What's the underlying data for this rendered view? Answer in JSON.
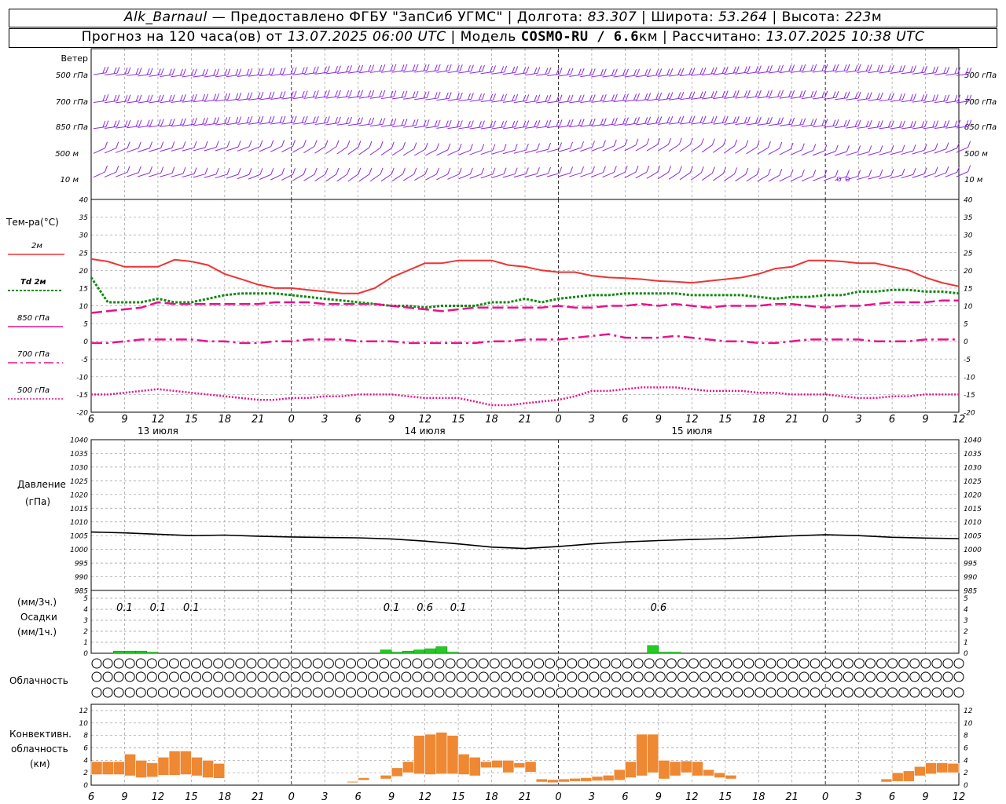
{
  "header": {
    "station": "Alk_Barnaul",
    "dash": "—",
    "provided_by": "Предоставлено ФГБУ \"ЗапСиб УГМС\"",
    "lon_label": "Долгота:",
    "lon_value": "83.307",
    "lat_label": "Широта:",
    "lat_value": "53.264",
    "alt_label": "Высота:",
    "alt_value": "223",
    "alt_unit": "м",
    "forecast_prefix": "Прогноз на 120 часа(ов) от",
    "forecast_start": "13.07.2025 06:00 UTC",
    "model_label": "Модель",
    "model_name": "COSMO-RU / 6.6",
    "model_unit": "км",
    "calc_label": "Рассчитано:",
    "calc_time": "13.07.2025 10:38 UTC"
  },
  "time_axis": {
    "hour_ticks": [
      "6",
      "9",
      "12",
      "15",
      "18",
      "21",
      "0",
      "3",
      "6",
      "9",
      "12",
      "15",
      "18",
      "21",
      "0",
      "3",
      "6",
      "9",
      "12",
      "15",
      "18",
      "21",
      "0",
      "3",
      "6",
      "9",
      "12"
    ],
    "day_labels": [
      "13 июля",
      "14 июля",
      "15 июля"
    ]
  },
  "wind_panel": {
    "title": "Ветер",
    "levels": [
      "500 гПа",
      "700 гПа",
      "850 гПа",
      "500 м",
      "10 м"
    ],
    "calm_marks": [
      "o",
      "o"
    ]
  },
  "temp_panel": {
    "title": "Тем-ра(°C)",
    "legend": [
      "2м",
      "Td 2м",
      "850 гПа",
      "700 гПа",
      "500 гПа"
    ],
    "ticks": [
      "40",
      "35",
      "30",
      "25",
      "20",
      "15",
      "10",
      "5",
      "0",
      "-5",
      "-10",
      "-15",
      "-20"
    ]
  },
  "pressure_panel": {
    "title_line1": "Давление",
    "title_line2": "(гПа)",
    "ticks": [
      "1040",
      "1035",
      "1030",
      "1025",
      "1020",
      "1015",
      "1010",
      "1005",
      "1000",
      "995",
      "990",
      "985"
    ]
  },
  "precip_panel": {
    "label_top": "(мм/3ч.)",
    "label_mid": "Осадки",
    "label_bot": "(мм/1ч.)",
    "ticks": [
      "5",
      "4",
      "3",
      "2",
      "1",
      "0"
    ],
    "amount_labels": [
      {
        "hour": 3,
        "text": "0.1"
      },
      {
        "hour": 6,
        "text": "0.1"
      },
      {
        "hour": 9,
        "text": "0.1"
      },
      {
        "hour": 27,
        "text": "0.1"
      },
      {
        "hour": 30,
        "text": "0.6"
      },
      {
        "hour": 33,
        "text": "0.1"
      },
      {
        "hour": 51,
        "text": "0.6"
      }
    ]
  },
  "cloud_panel": {
    "title": "Облачность"
  },
  "conv_panel": {
    "title_line1": "Конвективн.",
    "title_line2": "облачность",
    "title_line3": "(км)",
    "ticks": [
      "12",
      "10",
      "8",
      "6",
      "4",
      "2",
      "0"
    ]
  },
  "colors": {
    "wind": "#8a2be2",
    "t2m": "#ee3333",
    "td2m": "#118811",
    "t850": "#e8128c",
    "t700": "#e8128c",
    "t500": "#e8128c",
    "pressure": "#000000",
    "precip": "#22cc22",
    "conv": "#ee8833",
    "grid": "#9a9a9a"
  },
  "chart_data": [
    {
      "type": "line",
      "title": "Тем-ра(°C)",
      "ylim": [
        -20,
        40
      ],
      "x_hours": [
        0,
        1.5,
        3,
        4.5,
        6,
        7.5,
        9,
        10.5,
        12,
        13.5,
        15,
        16.5,
        18,
        19.5,
        21,
        22.5,
        24,
        25.5,
        27,
        28.5,
        30,
        31.5,
        33,
        34.5,
        36,
        37.5,
        39,
        40.5,
        42,
        43.5,
        45,
        46.5,
        48,
        49.5,
        51,
        52.5,
        54,
        55.5,
        57,
        58.5,
        60,
        61.5,
        63,
        64.5,
        66,
        67.5,
        69,
        70.5,
        72,
        73.5,
        75,
        76.5,
        78
      ],
      "series": [
        {
          "name": "2м",
          "values": [
            23.2,
            22.5,
            21,
            21,
            21,
            23,
            22.5,
            21.5,
            19,
            17.5,
            16,
            15,
            15,
            14.5,
            14,
            13.5,
            13.5,
            15,
            18,
            20,
            22,
            22,
            22.8,
            22.8,
            22.8,
            21.5,
            21,
            20,
            19.5,
            19.5,
            18.5,
            18,
            17.8,
            17.5,
            17,
            16.8,
            16.5,
            17,
            17.5,
            18,
            19,
            20.5,
            21,
            22.8,
            22.8,
            22.5,
            22,
            22,
            21,
            20,
            18,
            16.5,
            15.5
          ]
        },
        {
          "name": "Td 2м",
          "values": [
            18,
            11,
            11,
            11,
            12,
            11,
            11,
            12,
            13,
            13.5,
            13.5,
            13.5,
            13,
            12.5,
            12,
            11.5,
            11,
            10.5,
            10,
            10,
            9.5,
            10,
            10,
            10,
            11,
            11,
            12,
            11,
            12,
            12.5,
            13,
            13,
            13.5,
            13.5,
            13.5,
            13.5,
            13,
            13,
            13,
            13,
            12.5,
            12,
            12.5,
            12.5,
            13,
            13,
            14,
            14,
            14.5,
            14.5,
            14,
            14,
            13.5
          ]
        },
        {
          "name": "850 гПа",
          "values": [
            8,
            8.5,
            9,
            9.5,
            11,
            10.5,
            10.5,
            10.5,
            10.5,
            10.5,
            10.5,
            11,
            11,
            11,
            10.5,
            10.5,
            10.5,
            10.5,
            10,
            9.5,
            9,
            8.5,
            9,
            9.5,
            9.5,
            9.5,
            9.5,
            9.5,
            10,
            9.5,
            9.5,
            10,
            10,
            10.5,
            10,
            10.5,
            10,
            9.5,
            10,
            10,
            10,
            10.5,
            10.5,
            10,
            9.5,
            10,
            10,
            10.5,
            11,
            11,
            11,
            11.5,
            11.5
          ]
        },
        {
          "name": "700 гПа",
          "values": [
            -0.5,
            -0.5,
            0,
            0.5,
            0.5,
            0.5,
            0.5,
            0,
            0,
            -0.5,
            -0.5,
            0,
            0,
            0.5,
            0.5,
            0.5,
            0,
            0,
            0,
            -0.5,
            -0.5,
            -0.5,
            -0.5,
            -0.5,
            0,
            0,
            0.5,
            0.5,
            0.5,
            1,
            1.5,
            2,
            1,
            1,
            1,
            1.5,
            1,
            0.5,
            0,
            0,
            -0.5,
            -0.5,
            0,
            0.5,
            0.5,
            0.5,
            0.5,
            0,
            0,
            0,
            0.5,
            0.5,
            0.5
          ]
        },
        {
          "name": "500 гПа",
          "values": [
            -15,
            -15,
            -14.5,
            -14,
            -13.5,
            -14,
            -14.5,
            -15,
            -15.5,
            -16,
            -16.5,
            -16.5,
            -16,
            -16,
            -15.5,
            -15.5,
            -15,
            -15,
            -15,
            -15.5,
            -16,
            -16,
            -16,
            -17,
            -18,
            -18,
            -17.5,
            -17,
            -16.5,
            -15.5,
            -14,
            -14,
            -13.5,
            -13,
            -13,
            -13,
            -13.5,
            -14,
            -14,
            -14,
            -14.5,
            -14.5,
            -15,
            -15,
            -15,
            -15.5,
            -16,
            -16,
            -15.5,
            -15.5,
            -15,
            -15,
            -15
          ]
        }
      ]
    },
    {
      "type": "line",
      "title": "Давление",
      "ylabel": "(гПа)",
      "ylim": [
        985,
        1040
      ],
      "x_hours": [
        0,
        3,
        6,
        9,
        12,
        15,
        18,
        21,
        24,
        27,
        30,
        33,
        36,
        39,
        42,
        45,
        48,
        51,
        54,
        57,
        60,
        63,
        66,
        69,
        72,
        75,
        78
      ],
      "series": [
        {
          "name": "Давление",
          "values": [
            1006.3,
            1006,
            1005.5,
            1005,
            1005.2,
            1004.8,
            1004.5,
            1004.3,
            1004.2,
            1003.8,
            1003,
            1002,
            1000.8,
            1000.3,
            1001,
            1002,
            1002.7,
            1003.2,
            1003.6,
            1003.9,
            1004.4,
            1004.9,
            1005.3,
            1005,
            1004.4,
            1004.1,
            1003.9
          ]
        }
      ]
    },
    {
      "type": "bar",
      "title": "Осадки",
      "ylabel": "(мм/1ч.)",
      "ylim": [
        0,
        5
      ],
      "x_hours": [
        3,
        4,
        5,
        6,
        27,
        28,
        29,
        30,
        31,
        32,
        33,
        51,
        52,
        53
      ],
      "values": [
        0.2,
        0.2,
        0.2,
        0.1,
        0.3,
        0.1,
        0.2,
        0.3,
        0.4,
        0.6,
        0.1,
        0.7,
        0.1,
        0.1
      ]
    },
    {
      "type": "bar",
      "title": "Конвективн. облачность",
      "ylabel": "(км)",
      "ylim": [
        0,
        12
      ],
      "x_hours": [
        1,
        2,
        3,
        4,
        5,
        6,
        7,
        8,
        9,
        10,
        11,
        12,
        24,
        25,
        27,
        28,
        29,
        30,
        31,
        32,
        33,
        34,
        35,
        36,
        37,
        38,
        39,
        40,
        41,
        42,
        43,
        44,
        45,
        46,
        47,
        48,
        49,
        50,
        51,
        52,
        53,
        54,
        55,
        56,
        57,
        58,
        72,
        73,
        74,
        75,
        76,
        77,
        78
      ],
      "bottoms": [
        1.7,
        1.7,
        1.7,
        1.5,
        1.2,
        1.3,
        1.6,
        1.6,
        1.7,
        1.5,
        1.2,
        1.1,
        0.4,
        0.8,
        1.0,
        1.4,
        2.0,
        1.8,
        1.7,
        1.8,
        1.8,
        1.7,
        1.5,
        2.8,
        2.8,
        2.0,
        2.8,
        2.1,
        0.5,
        0.4,
        0.5,
        0.6,
        0.6,
        0.7,
        0.7,
        0.8,
        1.2,
        1.5,
        2.0,
        1.0,
        1.5,
        2.0,
        1.5,
        1.5,
        1.2,
        1.0,
        0.5,
        0.6,
        0.6,
        1.5,
        1.8,
        2.0,
        2.0
      ],
      "tops": [
        3.8,
        3.8,
        3.8,
        5.0,
        4.0,
        3.6,
        4.5,
        5.5,
        5.5,
        4.5,
        4.0,
        3.5,
        0.6,
        1.2,
        1.6,
        2.8,
        3.8,
        8.0,
        8.2,
        8.5,
        8.0,
        5.0,
        4.5,
        3.8,
        4.0,
        4.0,
        3.6,
        3.8,
        1.0,
        0.9,
        1.0,
        1.1,
        1.2,
        1.4,
        1.6,
        2.5,
        3.8,
        8.2,
        8.2,
        4.0,
        3.8,
        3.9,
        3.8,
        2.5,
        2.0,
        1.6,
        1.0,
        2.0,
        2.3,
        3.0,
        3.6,
        3.6,
        3.5
      ]
    }
  ]
}
